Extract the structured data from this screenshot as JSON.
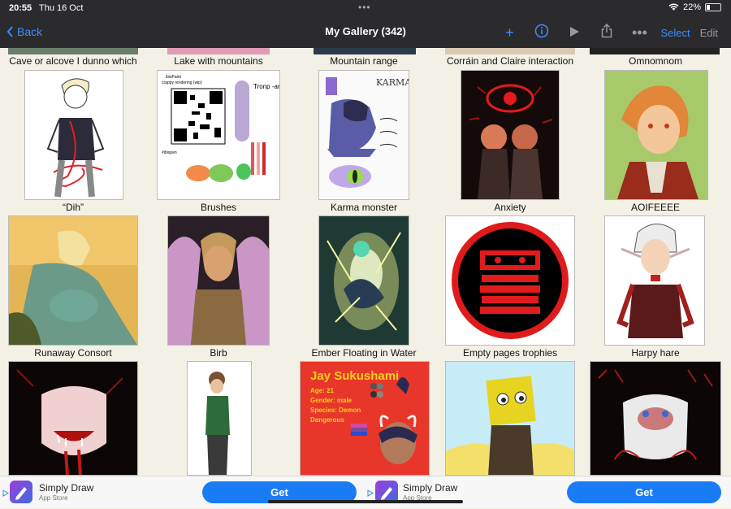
{
  "status": {
    "time": "20:55",
    "date": "Thu 16 Oct",
    "battery": "22%",
    "battery_level": 0.22
  },
  "nav": {
    "back": "Back",
    "title": "My Gallery (342)",
    "select": "Select",
    "edit": "Edit"
  },
  "top_row_labels": [
    "Cave or alcove I dunno which",
    "Lake with mountains",
    "Mountain range",
    "Corráin and Claire interaction",
    "Omnomnom"
  ],
  "row1": [
    "“Dih”",
    "Brushes",
    "Karma monster",
    "Anxiety",
    "AOIFEEEE"
  ],
  "row2": [
    "Runaway Consort",
    "Birb",
    "Ember Floating in Water",
    "Empty pages trophies",
    "Harpy hare"
  ],
  "brushes_card": {
    "app": "ibisPaint",
    "note": "crappy rendering (wip)",
    "tag": "#ibispen",
    "scribble": "Tronp -arche"
  },
  "karma_card": {
    "heading": "KARMA"
  },
  "jay_card": {
    "name": "Jay Sukushami",
    "age": "Age: 21",
    "gender": "Gender: male",
    "species": "Species: Demon",
    "trait": "Dangerous"
  },
  "ad": {
    "name": "Simply Draw",
    "sub": "App Store",
    "button": "Get"
  }
}
